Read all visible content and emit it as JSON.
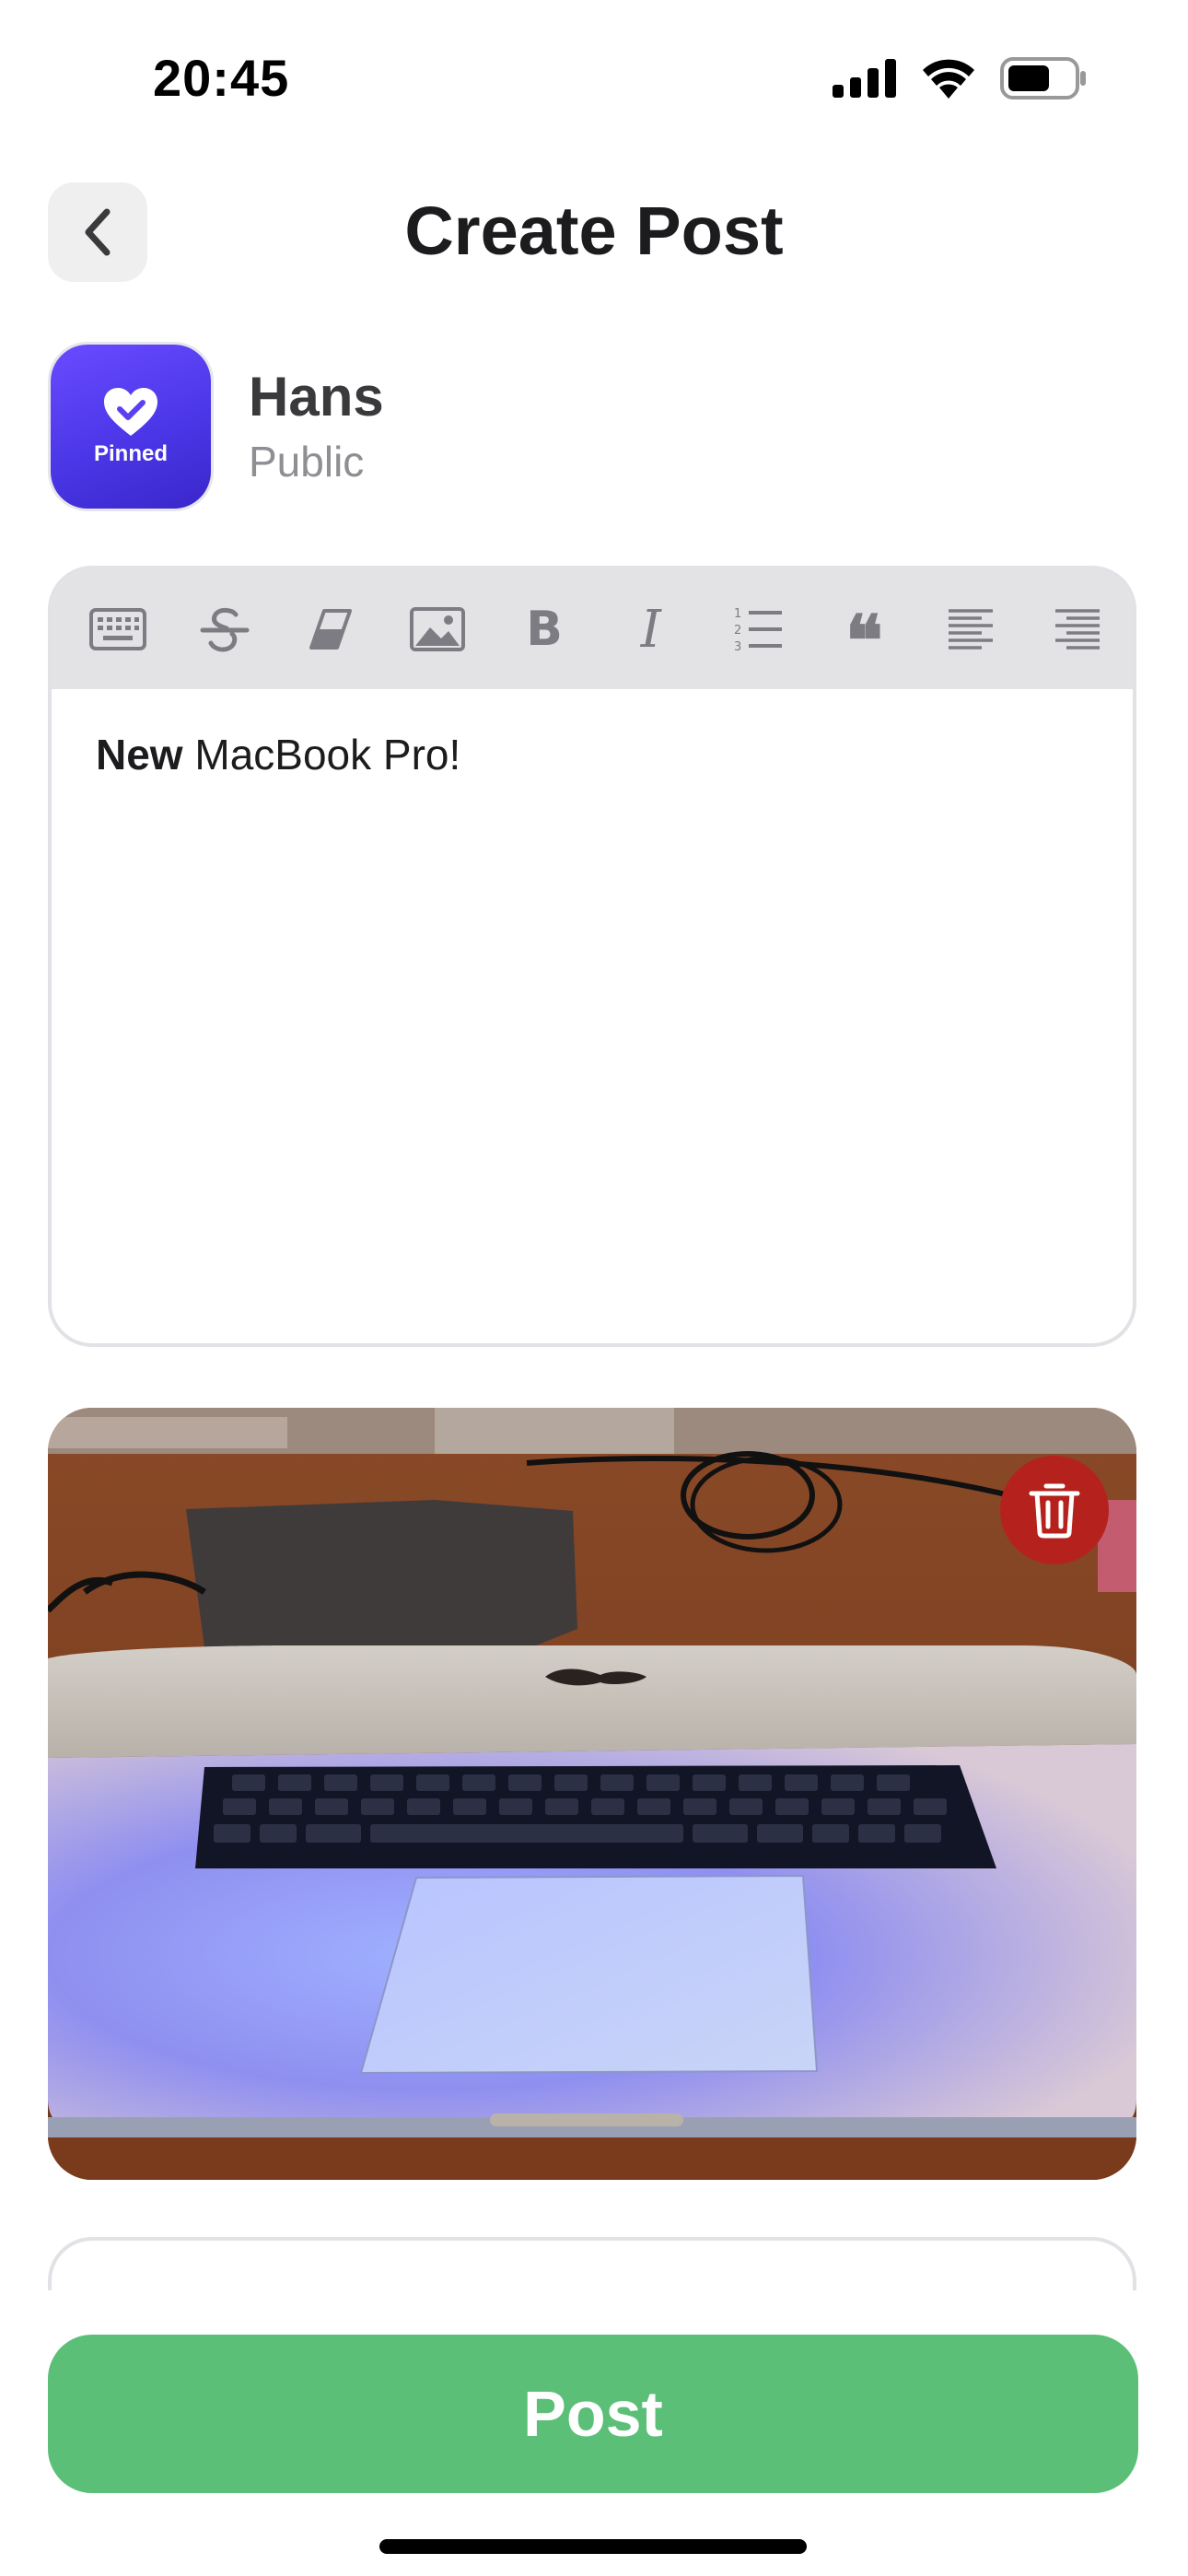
{
  "status_bar": {
    "time": "20:45",
    "icons": [
      "cellular-signal-icon",
      "wifi-icon",
      "battery-icon"
    ]
  },
  "header": {
    "title": "Create Post",
    "back_icon": "chevron-left-icon"
  },
  "author": {
    "name": "Hans",
    "visibility": "Public",
    "avatar_label": "Pinned",
    "avatar_icon": "heart-check-icon"
  },
  "toolbar": {
    "tools": [
      "keyboard-icon",
      "strikethrough-icon",
      "eraser-icon",
      "image-icon",
      "bold-icon",
      "italic-icon",
      "ordered-list-icon",
      "quote-icon",
      "align-left-icon",
      "align-right-icon"
    ],
    "bold_glyph": "B",
    "italic_glyph": "I",
    "quote_glyph": "❝"
  },
  "editor": {
    "bold_text": "New",
    "text": " MacBook Pro!"
  },
  "attachment": {
    "delete_icon": "trash-icon"
  },
  "post_button": {
    "label": "Post"
  },
  "colors": {
    "accent_green": "#5bbf77",
    "delete_red": "#b5221d",
    "avatar_purple": "#4b37e8",
    "toolbar_gray": "#e3e3e6"
  }
}
